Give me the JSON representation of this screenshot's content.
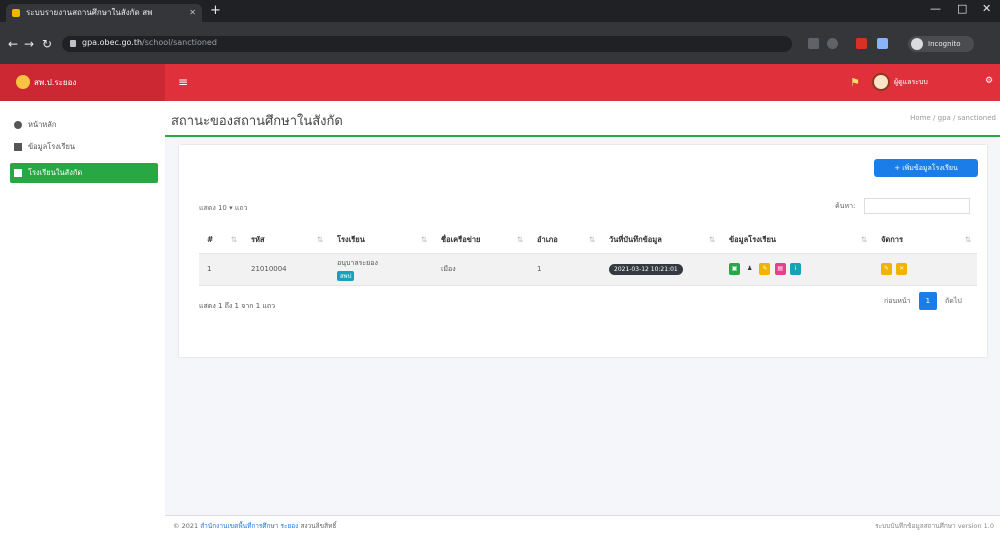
{
  "browser": {
    "tab_title": "ระบบรายงานสถานศึกษาในสังกัด สพ",
    "tab_close": "✕",
    "new_tab": "+",
    "url_host": "gpa.obec.go.th",
    "url_path": "/school/sanctioned",
    "profile_label": "Incognito"
  },
  "app": {
    "brand": "สพ.ป.ระยอง",
    "header_user": "ผู้ดูแลระบบ",
    "colors": {
      "header": "#e0303c",
      "brand": "#cc2833",
      "accent": "#28a745",
      "primary": "#1a7de8"
    }
  },
  "sidebar": {
    "items": [
      {
        "label": "หน้าหลัก",
        "icon": "dashboard-icon"
      },
      {
        "label": "ข้อมูลโรงเรียน",
        "icon": "list-icon"
      },
      {
        "label": "โรงเรียนในสังกัด",
        "icon": "file-icon",
        "active": true
      }
    ]
  },
  "page": {
    "title": "สถานะของสถานศึกษาในสังกัด",
    "breadcrumb": "Home / gpa / sanctioned"
  },
  "toolbar": {
    "add_button": "+ เพิ่มข้อมูลโรงเรียน"
  },
  "table_controls": {
    "show_entries": "แสดง 10 ▾ แถว",
    "search_label": "ค้นหา:",
    "search_placeholder": ""
  },
  "table": {
    "columns": [
      "#",
      "รหัส",
      "โรงเรียน",
      "ชื่อเครือข่าย",
      "อำเภอ",
      "วันที่บันทึกข้อมูล",
      "ข้อมูลโรงเรียน",
      "จัดการ"
    ],
    "rows": [
      {
        "no": "1",
        "code": "21010004",
        "school": "อนุบาลระยอง",
        "school_badge": "สพป",
        "network": "เมือง",
        "district": "1",
        "date": "2021-03-12 10:21:01"
      }
    ]
  },
  "footer_table": {
    "info": "แสดง 1 ถึง 1 จาก 1 แถว",
    "prev": "ก่อนหน้า",
    "page": "1",
    "next": "ถัดไป"
  },
  "footer": {
    "copyright": "© 2021",
    "link": "สำนักงานเขตพื้นที่การศึกษา ระยอง",
    "suffix": "สงวนลิขสิทธิ์",
    "right": "ระบบบันทึกข้อมูลสถานศึกษา version 1.0"
  }
}
